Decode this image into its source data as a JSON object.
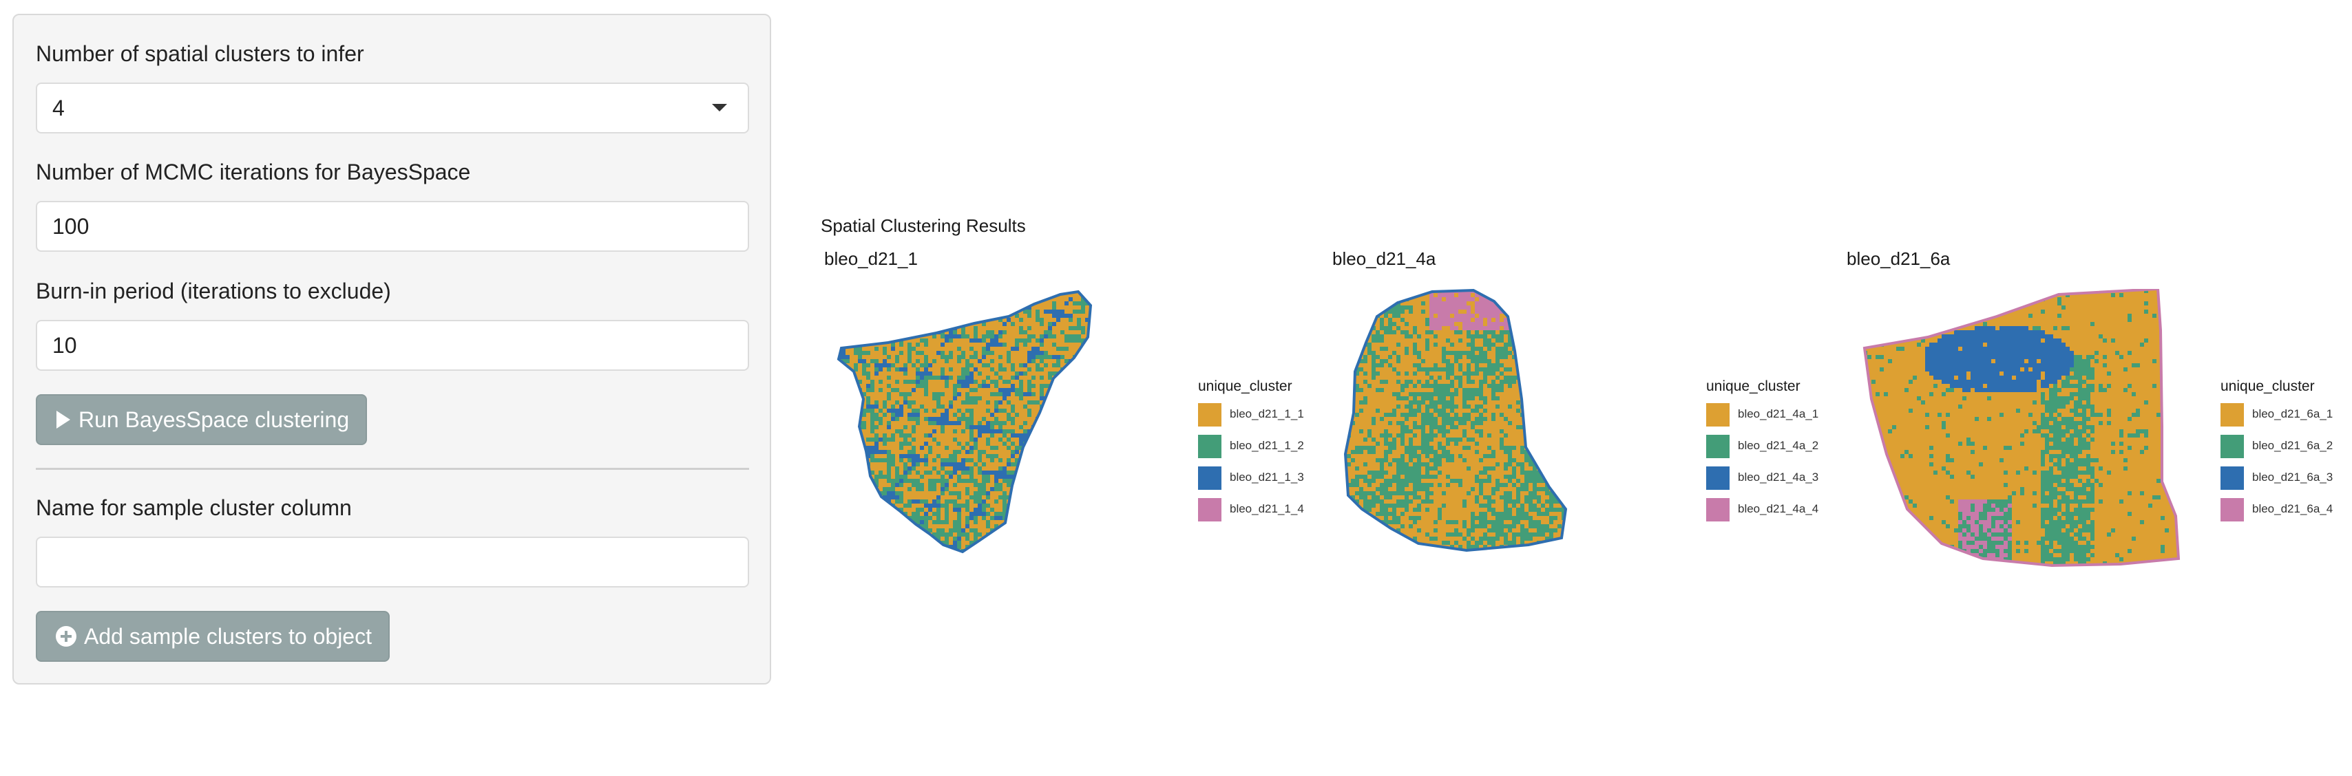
{
  "sidebar": {
    "clusters": {
      "label": "Number of spatial clusters to infer",
      "value": "4"
    },
    "mcmc": {
      "label": "Number of MCMC iterations for BayesSpace",
      "value": "100"
    },
    "burnin": {
      "label": "Burn-in period (iterations to exclude)",
      "value": "10"
    },
    "run_button": {
      "label": "Run BayesSpace clustering",
      "icon": "play-icon"
    },
    "name_field": {
      "label": "Name for sample cluster column",
      "value": ""
    },
    "add_button": {
      "label": "Add sample clusters to object",
      "icon": "plus-circle-icon"
    }
  },
  "colors": {
    "cluster_1": "#DDA032",
    "cluster_2": "#439D78",
    "cluster_3": "#2E6EB0",
    "cluster_4": "#C87BAA",
    "panel_bg": "#f5f5f5",
    "button_bg": "#95a5a6"
  },
  "chart_data": {
    "type": "heatmap",
    "title": "Spatial Clustering Results",
    "legend_position": "right",
    "facets": [
      {
        "title": "bleo_d21_1",
        "legend_title": "unique_cluster",
        "legend": [
          "bleo_d21_1_1",
          "bleo_d21_1_2",
          "bleo_d21_1_3",
          "bleo_d21_1_4"
        ]
      },
      {
        "title": "bleo_d21_4a",
        "legend_title": "unique_cluster",
        "legend": [
          "bleo_d21_4a_1",
          "bleo_d21_4a_2",
          "bleo_d21_4a_3",
          "bleo_d21_4a_4"
        ]
      },
      {
        "title": "bleo_d21_6a",
        "legend_title": "unique_cluster",
        "legend": [
          "bleo_d21_6a_1",
          "bleo_d21_6a_2",
          "bleo_d21_6a_3",
          "bleo_d21_6a_4"
        ]
      }
    ]
  }
}
